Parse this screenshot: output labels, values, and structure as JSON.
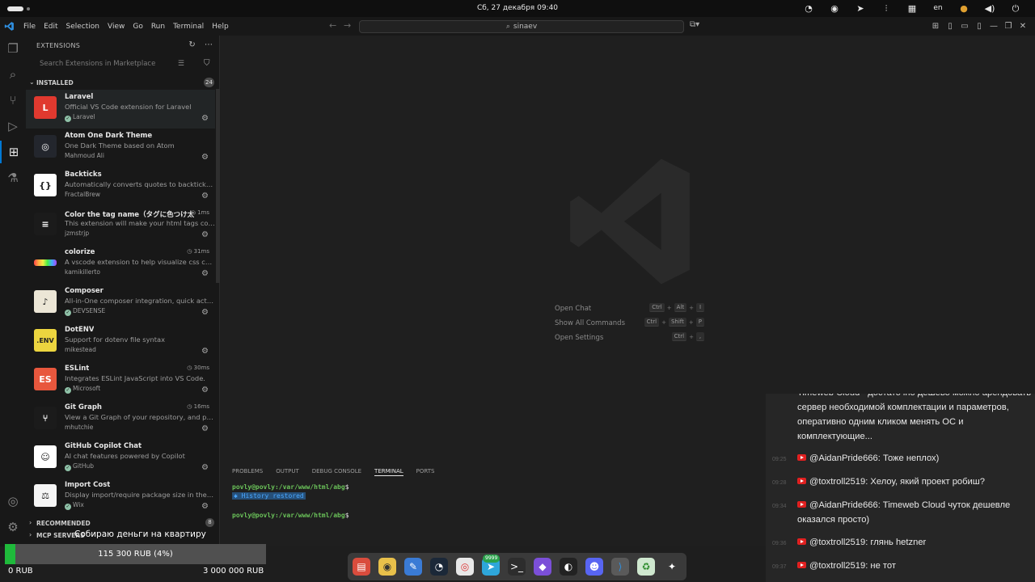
{
  "system": {
    "clock": "Сб, 27 декабря  09:40",
    "language": "en",
    "tray_icons": [
      "vpn-icon",
      "steam-tray-icon",
      "telegram-tray-icon",
      "equalizer-icon",
      "network-icon",
      "language-indicator",
      "microphone-icon",
      "volume-icon",
      "power-icon"
    ]
  },
  "menubar": {
    "items": [
      "File",
      "Edit",
      "Selection",
      "View",
      "Go",
      "Run",
      "Terminal",
      "Help"
    ],
    "search_value": "sinaev"
  },
  "sidebar": {
    "title": "EXTENSIONS",
    "search_placeholder": "Search Extensions in Marketplace",
    "installed_label": "INSTALLED",
    "installed_count": "24",
    "recommended_label": "RECOMMENDED",
    "recommended_count": "8",
    "mcp_label": "MCP SERVERS",
    "extensions": [
      {
        "name": "Laravel",
        "description": "Official VS Code extension for Laravel",
        "publisher": "Laravel",
        "verified": true,
        "time": "",
        "icon": "laravel-icon",
        "icon_bg": "#e0392f",
        "icon_text": "L"
      },
      {
        "name": "Atom One Dark Theme",
        "description": "One Dark Theme based on Atom",
        "publisher": "Mahmoud Ali",
        "verified": false,
        "time": "",
        "icon": "atom-icon",
        "icon_bg": "#23262d",
        "icon_text": "◎"
      },
      {
        "name": "Backticks",
        "description": "Automatically converts quotes to backticks w...",
        "publisher": "FractalBrew",
        "verified": false,
        "time": "",
        "icon": "backticks-icon",
        "icon_bg": "#ffffff",
        "icon_text": "{}"
      },
      {
        "name": "Color the tag name（タグに色つけ太...",
        "description": "This extension will make your html tags colorf...",
        "publisher": "jzmstrjp",
        "verified": false,
        "time": "1ms",
        "icon": "color-tag-icon",
        "icon_bg": "#1b1b1b",
        "icon_text": "≡"
      },
      {
        "name": "colorize",
        "description": "A vscode extension to help visualize css color...",
        "publisher": "kamikillerto",
        "verified": false,
        "time": "31ms",
        "icon": "colorize-icon",
        "icon_bg": "#f2f2f2",
        "icon_text": ""
      },
      {
        "name": "Composer",
        "description": "All-in-One composer integration, quick action...",
        "publisher": "DEVSENSE",
        "verified": true,
        "time": "",
        "icon": "composer-icon",
        "icon_bg": "#ece6d6",
        "icon_text": "♪"
      },
      {
        "name": "DotENV",
        "description": "Support for dotenv file syntax",
        "publisher": "mikestead",
        "verified": false,
        "time": "",
        "icon": "dotenv-icon",
        "icon_bg": "#ecd53f",
        "icon_text": ".ENV"
      },
      {
        "name": "ESLint",
        "description": "Integrates ESLint JavaScript into VS Code.",
        "publisher": "Microsoft",
        "verified": true,
        "time": "30ms",
        "icon": "eslint-icon",
        "icon_bg": "#e8573d",
        "icon_text": "ES"
      },
      {
        "name": "Git Graph",
        "description": "View a Git Graph of your repository, and perf...",
        "publisher": "mhutchie",
        "verified": false,
        "time": "16ms",
        "icon": "git-graph-icon",
        "icon_bg": "#1b1b1b",
        "icon_text": "⑂"
      },
      {
        "name": "GitHub Copilot Chat",
        "description": "AI chat features powered by Copilot",
        "publisher": "GitHub",
        "verified": true,
        "time": "",
        "icon": "copilot-icon",
        "icon_bg": "#ffffff",
        "icon_text": "☺"
      },
      {
        "name": "Import Cost",
        "description": "Display import/require package size in the edi...",
        "publisher": "Wix",
        "verified": true,
        "time": "",
        "icon": "import-cost-icon",
        "icon_bg": "#f5f5f5",
        "icon_text": "⚖"
      }
    ]
  },
  "editor": {
    "shortcuts": [
      {
        "label": "Open Chat",
        "keys": [
          "Ctrl",
          "Alt",
          "I"
        ]
      },
      {
        "label": "Show All Commands",
        "keys": [
          "Ctrl",
          "Shift",
          "P"
        ]
      },
      {
        "label": "Open Settings",
        "keys": [
          "Ctrl",
          ","
        ]
      }
    ]
  },
  "panel": {
    "tabs": [
      "PROBLEMS",
      "OUTPUT",
      "DEBUG CONSOLE",
      "TERMINAL",
      "PORTS"
    ],
    "active_tab": "TERMINAL",
    "prompt": "povly@povly:/var/www/html/abg",
    "prompt_suffix": "$",
    "history_restored": "History restored",
    "history_marker": "✱"
  },
  "chat": {
    "first_message": "Timeweb Cloud - достаточно дешево можно арендовать сервер необходимой комплектации и параметров, оперативно одним кликом менять ОС и комплектующие...",
    "messages": [
      {
        "time": "09:25",
        "author": "@AidanPride666:",
        "text": "Тоже неплох)"
      },
      {
        "time": "09:28",
        "author": "@toxtroll2519:",
        "text": "Хелоу, який проект робиш?"
      },
      {
        "time": "09:34",
        "author": "@AidanPride666:",
        "text": "Timeweb Cloud чуток дешевле оказался просто)"
      },
      {
        "time": "09:36",
        "author": "@toxtroll2519:",
        "text": "глянь hetzner"
      },
      {
        "time": "09:37",
        "author": "@toxtroll2519:",
        "text": "не тот"
      }
    ]
  },
  "fundraising": {
    "title": "Собираю деньги на квартиру",
    "amount": "115 300 RUB (4%)",
    "progress_percent": 4,
    "min_label": "0 RUB",
    "max_label": "3 000 000 RUB"
  },
  "dock": {
    "badge": "9999",
    "apps": [
      "files-icon",
      "rhythmbox-icon",
      "text-editor-icon",
      "steam-icon",
      "chrome-icon",
      "telegram-icon",
      "terminal-icon",
      "obsidian-icon",
      "obs-icon",
      "discord-icon",
      "vscode-icon",
      "trash-icon",
      "app-grid-icon"
    ]
  },
  "colors": {
    "accent": "#0078d4",
    "terminal_prompt": "#6ac259",
    "progress_fill": "#1fba3b",
    "youtube_red": "#e02020"
  }
}
